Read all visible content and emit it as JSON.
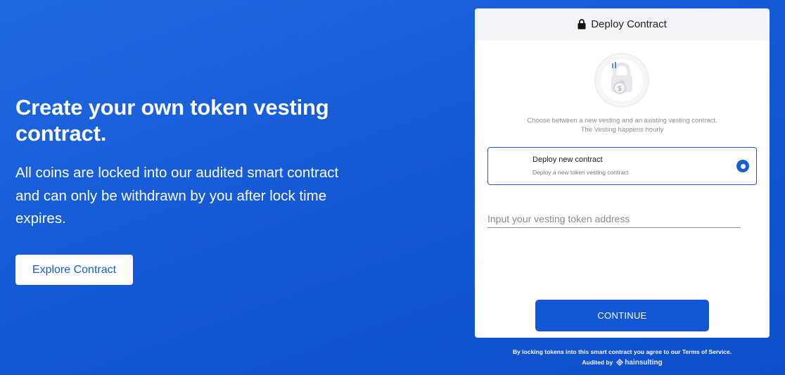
{
  "hero": {
    "title": "Create your own token vesting contract.",
    "description": "All coins are locked into our audited smart contract and can only be withdrawn by you after lock time expires.",
    "explore_label": "Explore Contract"
  },
  "card": {
    "header_icon": "lock-icon",
    "header_title": "Deploy Contract",
    "illustration_icon": "padlock-coin-icon",
    "hint_line1": "Choose between a new vesting and an axisting vesting contract.",
    "hint_line2": "The Vesting happens hourly",
    "option": {
      "title": "Deploy new contract",
      "subtitle": "Deploy a new token vesting contract",
      "selected": true
    },
    "input": {
      "placeholder": "Input your vesting token address",
      "value": ""
    },
    "continue_label": "CONTINUE"
  },
  "footer": {
    "terms": "By locking tokens into this smart contract you agree to our Terms of Service.",
    "audited_prefix": "Audited by",
    "brand": "hainsulting",
    "brand_icon": "chainsulting-logo-icon"
  },
  "colors": {
    "background": "#1659d6",
    "accent": "#1257d3",
    "card_header": "#f3f4f7"
  }
}
